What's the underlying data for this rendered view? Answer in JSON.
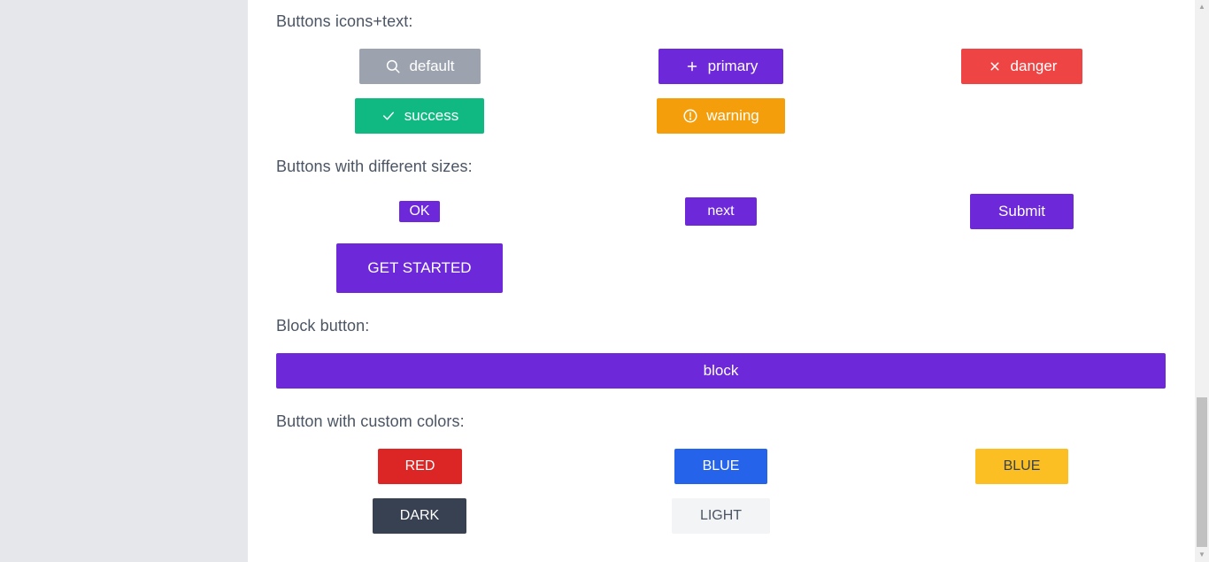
{
  "sections": {
    "icons_text": {
      "heading": "Buttons icons+text:",
      "buttons": {
        "default": {
          "label": "default",
          "icon": "search-icon",
          "color": "#9ca3af"
        },
        "primary": {
          "label": "primary",
          "icon": "plus-icon",
          "color": "#6d28d9"
        },
        "danger": {
          "label": "danger",
          "icon": "close-icon",
          "color": "#ef4444"
        },
        "success": {
          "label": "success",
          "icon": "check-icon",
          "color": "#10b981"
        },
        "warning": {
          "label": "warning",
          "icon": "alert-circle-icon",
          "color": "#f59e0b"
        }
      }
    },
    "sizes": {
      "heading": "Buttons with different sizes:",
      "buttons": {
        "xs": "OK",
        "sm": "next",
        "md": "Submit",
        "lg": "GET STARTED"
      }
    },
    "block": {
      "heading": "Block button:",
      "button": "block"
    },
    "custom": {
      "heading": "Button with custom colors:",
      "buttons": {
        "red": {
          "label": "RED",
          "color": "#dc2626"
        },
        "blue": {
          "label": "BLUE",
          "color": "#2563eb"
        },
        "yellow": {
          "label": "BLUE",
          "color": "#fbbf24"
        },
        "dark": {
          "label": "DARK",
          "color": "#374151"
        },
        "light": {
          "label": "LIGHT",
          "color": "#f3f4f6"
        }
      }
    }
  }
}
